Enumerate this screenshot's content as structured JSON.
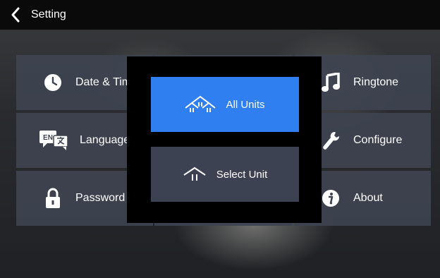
{
  "header": {
    "title": "Setting",
    "back_icon": "chevron-left-icon"
  },
  "tiles": [
    {
      "label": "Date & Time",
      "icon": "clock-icon"
    },
    {
      "label": "Language",
      "icon": "language-icon"
    },
    {
      "label": "Password",
      "icon": "lock-icon"
    },
    {
      "label": "Ringtone",
      "icon": "music-note-icon"
    },
    {
      "label": "Configure",
      "icon": "wrench-icon"
    },
    {
      "label": "About",
      "icon": "info-icon"
    }
  ],
  "language_icon_text": "EN",
  "dialog": {
    "all_units_label": "All Units",
    "select_unit_label": "Select Unit"
  },
  "colors": {
    "accent": "#2f7ff0",
    "tile": "#3e4350",
    "dialog_button": "#3d4252",
    "topbar": "#0a0a0a"
  }
}
